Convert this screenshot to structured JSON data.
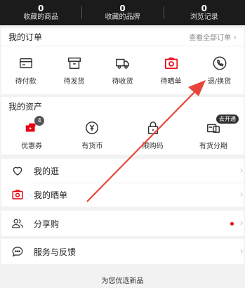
{
  "stats": [
    {
      "value": "0",
      "label": "收藏的商品"
    },
    {
      "value": "0",
      "label": "收藏的品牌"
    },
    {
      "value": "0",
      "label": "浏览记录"
    }
  ],
  "orders": {
    "title": "我的订单",
    "all_link": "查看全部订单",
    "items": [
      {
        "icon": "wallet-icon",
        "label": "待付款"
      },
      {
        "icon": "box-icon",
        "label": "待发货"
      },
      {
        "icon": "truck-icon",
        "label": "待收货"
      },
      {
        "icon": "camera-icon",
        "label": "待晒单"
      },
      {
        "icon": "phone-return-icon",
        "label": "退/换货"
      }
    ]
  },
  "assets": {
    "title": "我的资产",
    "items": [
      {
        "icon": "coupon-icon",
        "label": "优惠券",
        "badge": "4"
      },
      {
        "icon": "coin-icon",
        "label": "有货币"
      },
      {
        "icon": "lock-icon",
        "label": "限购码"
      },
      {
        "icon": "installment-icon",
        "label": "有货分期",
        "pill": "去开通"
      }
    ]
  },
  "menu": [
    {
      "icon": "heart-icon",
      "label": "我的逛"
    },
    {
      "icon": "camera-icon",
      "label": "我的晒单"
    },
    {
      "icon": "share-people-icon",
      "label": "分享购",
      "dot": true
    },
    {
      "icon": "chat-icon",
      "label": "服务与反馈"
    }
  ],
  "footer": {
    "label": "为您优选新品"
  },
  "colors": {
    "accent": "#e60012",
    "dark_bar": "#1b1b1b",
    "annotation_arrow": "#e8463c"
  }
}
